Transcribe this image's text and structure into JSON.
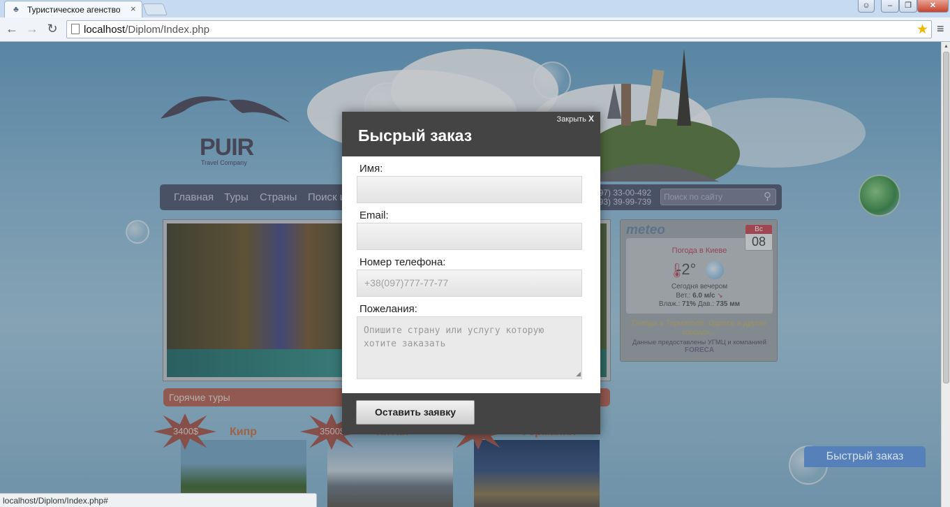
{
  "browser": {
    "tab_title": "Туристическое агенство",
    "url_host": "localhost",
    "url_path": "/Diplom/Index.php",
    "status_url": "localhost/Diplom/Index.php#"
  },
  "site": {
    "logo_word": "PUIR",
    "logo_sub": "Travel Company",
    "nav": [
      "Главная",
      "Туры",
      "Страны",
      "Поиск и"
    ],
    "phones": [
      "(097) 33-00-492",
      "(093) 39-99-739"
    ],
    "search_placeholder": "Поиск по сайту",
    "hot_tours_label": "Горячие туры",
    "tours": [
      {
        "name": "Кипр",
        "price": "3400$"
      },
      {
        "name": "Китай",
        "price": "3500$"
      },
      {
        "name": "Германия",
        "price": ""
      }
    ],
    "quick_order_label": "Быстрый заказ"
  },
  "weather": {
    "logo": "meteo",
    "day": "Вс",
    "date": "08",
    "city": "Погода в Киеве",
    "temp": "-2°",
    "period": "Сегодня вечером",
    "wind_label": "Вет.:",
    "wind_value": "6.0 м/с",
    "humidity_label": "Влаж.:",
    "humidity_value": "71%",
    "pressure_label": "Дав.:",
    "pressure_value": "735 мм",
    "other_cities": "Погода в Тернополе, Одессе и других городах...",
    "provided": "Данные предоставлены УГМЦ и компанией",
    "foreca": "FORECA"
  },
  "modal": {
    "close_label": "Закрыть",
    "close_x": "X",
    "title": "Бысрый заказ",
    "name_label": "Имя:",
    "email_label": "Email:",
    "phone_label": "Номер телефона:",
    "phone_placeholder": "+38(097)777-77-77",
    "wishes_label": "Пожелания:",
    "wishes_placeholder": "Опишите страну или услугу которую хотите заказать",
    "submit_label": "Оставить заявку"
  },
  "colors": {
    "modal_header": "#444444",
    "nav_bar": "#535a72",
    "hot_bar": "#b76656",
    "quick_order": "#5680b9"
  }
}
